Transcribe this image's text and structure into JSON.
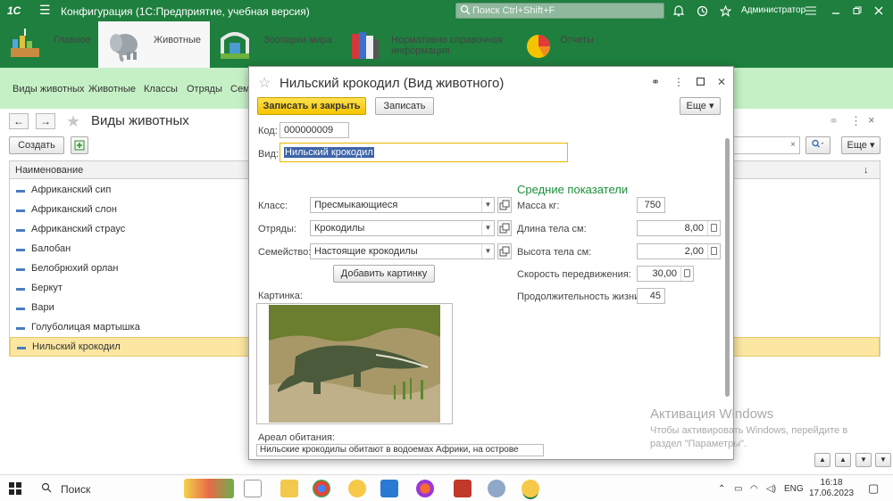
{
  "titlebar": {
    "logo": "1С",
    "title": "Конфигурация  (1С:Предприятие, учебная версия)",
    "search_placeholder": "Поиск Ctrl+Shift+F",
    "user": "Администратор"
  },
  "sections": [
    {
      "label": "Главное"
    },
    {
      "label": "Животные"
    },
    {
      "label": "Зоопарки мира"
    },
    {
      "label": "Нормативно справочная информация"
    },
    {
      "label": "Отчеты"
    }
  ],
  "subnav": [
    "Виды животных",
    "Животные",
    "Классы",
    "Отряды",
    "Семе"
  ],
  "list": {
    "title": "Виды животных",
    "create": "Создать",
    "more": "Еще",
    "column": "Наименование",
    "rows": [
      "Африканский сип",
      "Африканский слон",
      "Африканский страус",
      "Балобан",
      "Белобрюхий орлан",
      "Беркут",
      "Вари",
      "Голуболицая мартышка",
      "Нильский крокодил"
    ]
  },
  "modal": {
    "title": "Нильский крокодил (Вид животного)",
    "save_close": "Записать и закрыть",
    "save": "Записать",
    "more": "Еще",
    "code_label": "Код:",
    "code": "000000009",
    "kind_label": "Вид:",
    "kind": "Нильский крокодил",
    "class_label": "Класс:",
    "class": "Пресмыкающиеся",
    "order_label": "Отряды:",
    "order": "Крокодилы",
    "family_label": "Семейство:",
    "family": "Настоящие крокодилы",
    "add_picture": "Добавить картинку",
    "picture_label": "Картинка:",
    "habitat_label": "Ареал обитания:",
    "habitat": "Нильские крокодилы обитают в водоемах Африки, на острове",
    "avg_title": "Средние показатели",
    "mass_label": "Масса кг:",
    "mass": "750",
    "length_label": "Длина тела см:",
    "length": "8,00",
    "height_label": "Высота тела см:",
    "height": "2,00",
    "speed_label": "Скорость передвижения:",
    "speed": "30,00",
    "life_label": "Продолжительность жизни:",
    "life": "45"
  },
  "watermark": {
    "line1": "Активация Windows",
    "line2": "Чтобы активировать Windows, перейдите в раздел \"Параметры\"."
  },
  "taskbar": {
    "search": "Поиск",
    "lang": "ENG",
    "time": "16:18",
    "date": "17.06.2023"
  },
  "colors": {
    "brand_green": "#1e7f3e",
    "subnav_green": "#c5f0c5",
    "selection": "#fbe7a2",
    "save_yellow": "#f5c400",
    "section_title_green": "#1b8f3a"
  }
}
